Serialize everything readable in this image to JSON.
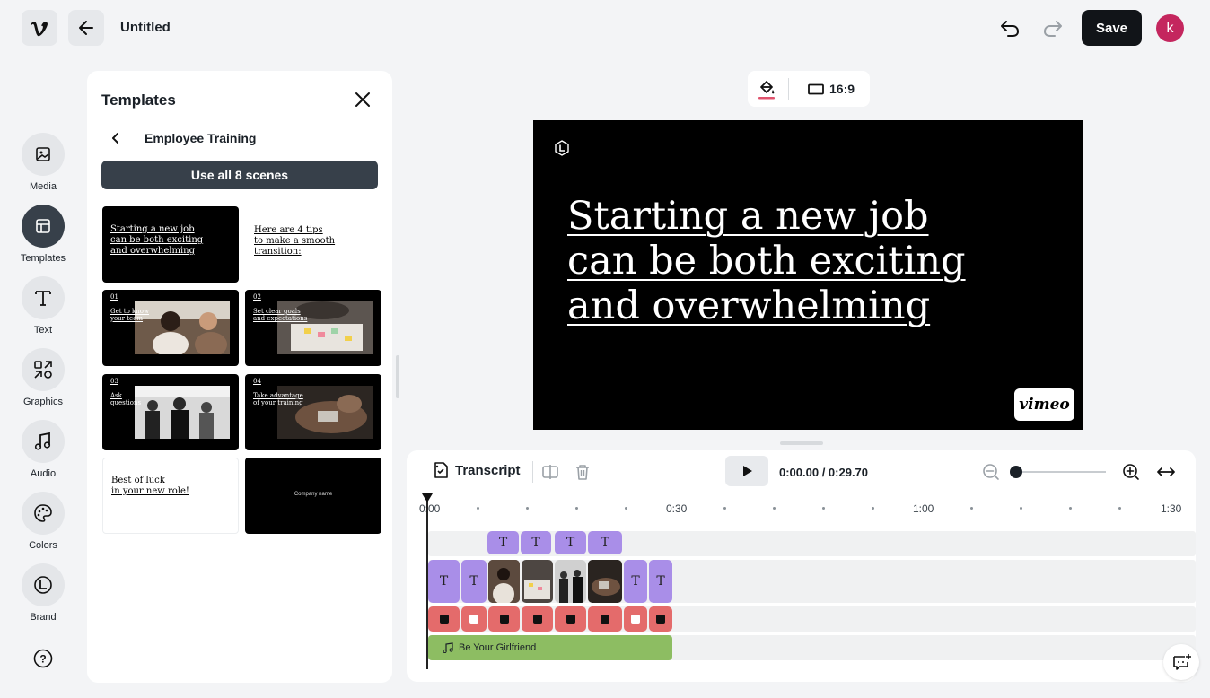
{
  "header": {
    "title": "Untitled",
    "save_label": "Save",
    "avatar_initial": "k",
    "avatar_color": "#c4265e",
    "icons": [
      "vimeo-logo-icon",
      "arrow-left-icon",
      "undo-icon",
      "redo-icon"
    ]
  },
  "sidebar": {
    "items": [
      {
        "label": "Media",
        "icon": "image-icon"
      },
      {
        "label": "Templates",
        "icon": "templates-icon"
      },
      {
        "label": "Text",
        "icon": "text-icon"
      },
      {
        "label": "Graphics",
        "icon": "graphics-icon"
      },
      {
        "label": "Audio",
        "icon": "music-note-icon"
      },
      {
        "label": "Colors",
        "icon": "palette-icon"
      },
      {
        "label": "Brand",
        "icon": "brand-icon"
      }
    ],
    "active": "Templates"
  },
  "templates_panel": {
    "title": "Templates",
    "subtitle": "Employee Training",
    "use_all_label": "Use all 8 scenes",
    "scenes": [
      {
        "text": "Starting a new job\ncan be both exciting\nand overwhelming"
      },
      {
        "text": "Here are 4 tips\nto make a smooth\ntransition:"
      },
      {
        "num": "01",
        "text": "Get to know\nyour team"
      },
      {
        "num": "02",
        "text": "Set clear goals\nand expectations"
      },
      {
        "num": "03",
        "text": "Ask\nquestions"
      },
      {
        "num": "04",
        "text": "Take advantage\nof your training"
      },
      {
        "text": "Best of luck\nin your new role!"
      },
      {
        "text": "Company name"
      }
    ]
  },
  "stage": {
    "aspect_ratio": "16:9",
    "canvas_text": "Starting a new job\ncan be both exciting\nand overwhelming",
    "watermark": "vimeo"
  },
  "timeline": {
    "transcript_label": "Transcript",
    "timecode": "0:00.00 / 0:29.70",
    "ruler_labels": [
      "0:00",
      "0:30",
      "1:00",
      "1:30"
    ],
    "text_clip_glyph": "T",
    "music_track": "Be Your Girlfriend",
    "colors": {
      "text_clip": "#a98ee8",
      "audio_clip": "#e46b6b",
      "music_clip": "#8dbd62"
    }
  }
}
